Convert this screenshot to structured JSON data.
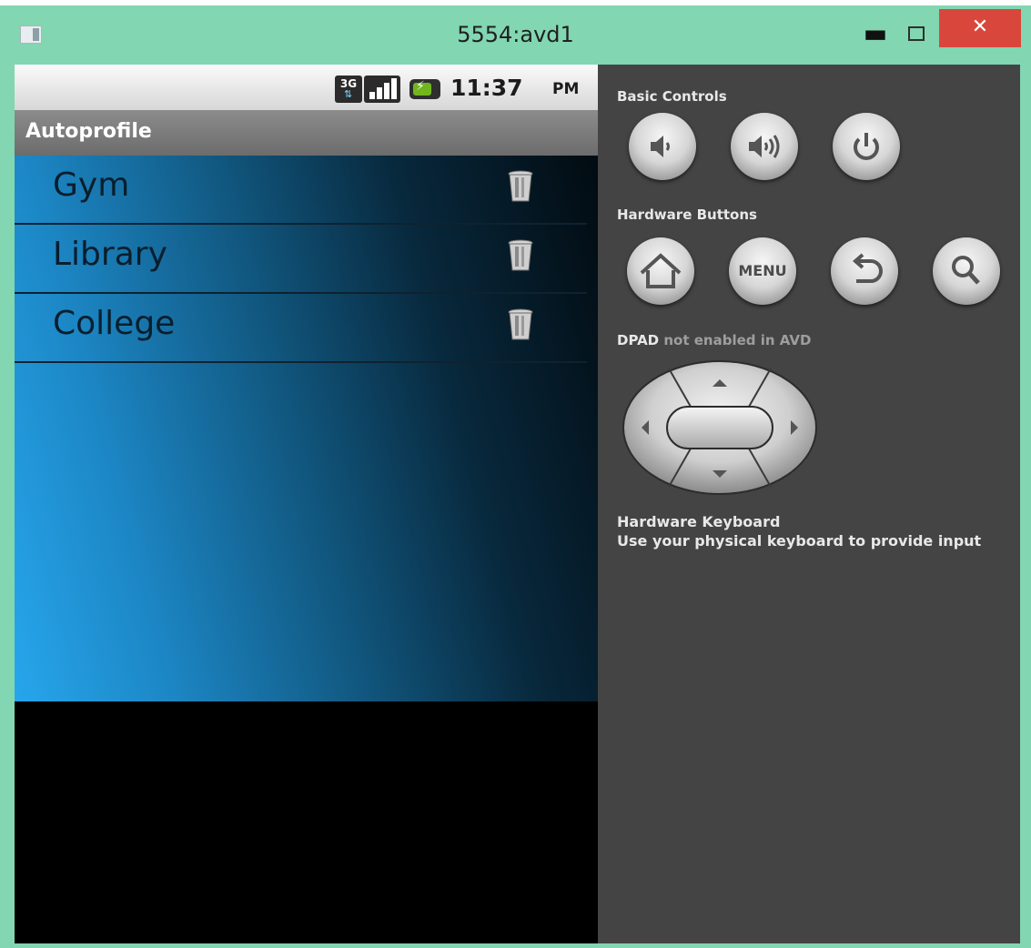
{
  "window": {
    "title": "5554:avd1",
    "minimize_glyph": "▬",
    "close_glyph": "✕",
    "icons": [
      "app-icon",
      "minimize-icon",
      "maximize-icon",
      "close-icon"
    ]
  },
  "statusbar": {
    "network": "3G",
    "time": "11:37",
    "ampm": "PM",
    "icons": [
      "3g-icon",
      "signal-icon",
      "battery-icon"
    ]
  },
  "app": {
    "title": "Autoprofile",
    "items": [
      {
        "label": "Gym",
        "icon": "trash-icon"
      },
      {
        "label": "Library",
        "icon": "trash-icon"
      },
      {
        "label": "College",
        "icon": "trash-icon"
      }
    ]
  },
  "panel": {
    "basic_controls_label": "Basic Controls",
    "basic_controls": [
      "volume-down-icon",
      "volume-up-icon",
      "power-icon"
    ],
    "hardware_buttons_label": "Hardware Buttons",
    "hardware_buttons": [
      "home-icon",
      "menu-button",
      "back-icon",
      "search-icon"
    ],
    "menu_label": "MENU",
    "dpad_label": "DPAD",
    "dpad_note": " not enabled in AVD",
    "keyboard_title": "Hardware Keyboard",
    "keyboard_text": "Use your physical keyboard to provide input"
  },
  "colors": {
    "window_frame": "#82d6b2",
    "close_button": "#d9473c",
    "panel_background": "#444444",
    "list_gradient_start": "#27a6ec",
    "list_gradient_end": "#020b11"
  }
}
